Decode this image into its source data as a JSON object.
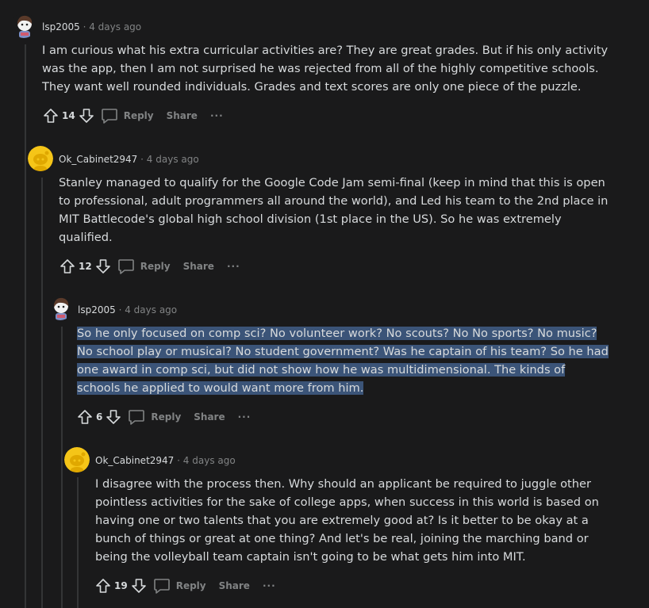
{
  "colors": {
    "background": "#1a1a1b",
    "text": "#d7dadc",
    "muted": "#818384",
    "thread_line": "#343536",
    "highlight": "#3b5478",
    "snoo_yellow": "#f5c518"
  },
  "comments": [
    {
      "username": "lsp2005",
      "separator": "·",
      "time": "4 days ago",
      "avatar": "snoo-girl-avatar",
      "paragraph": "I am curious what his extra curricular activities are? They are great grades. But if his only activity was the app, then I am not surprised he was rejected from all of the highly competitive schools. They want well rounded individuals. Grades and text scores are only one piece of the puzzle.",
      "score": "14",
      "reply_label": "Reply",
      "share_label": "Share",
      "more_label": "···"
    },
    {
      "username": "Ok_Cabinet2947",
      "separator": "·",
      "time": "4 days ago",
      "avatar": "snoo-yellow-avatar",
      "paragraph": "Stanley managed to qualify for the Google Code Jam semi-final (keep in mind that this is open to professional, adult programmers all around the world), and Led his team to the 2nd place in MIT Battlecode's global high school division (1st place in the US). So he was extremely qualified.",
      "score": "12",
      "reply_label": "Reply",
      "share_label": "Share",
      "more_label": "···"
    },
    {
      "username": "lsp2005",
      "separator": "·",
      "time": "4 days ago",
      "avatar": "snoo-girl-avatar",
      "paragraph": "So he only focused on comp sci? No volunteer work? No scouts? No No sports? No music? No school play or musical? No student government? Was he captain of his team? So he had one award in comp sci, but did not show how he was multidimensional. The kinds of schools he applied to would want more from him.",
      "score": "6",
      "reply_label": "Reply",
      "share_label": "Share",
      "more_label": "···"
    },
    {
      "username": "Ok_Cabinet2947",
      "separator": "·",
      "time": "4 days ago",
      "avatar": "snoo-yellow-avatar",
      "paragraph": "I disagree with the process then. Why should an applicant be required to juggle other pointless activities for the sake of college apps, when success in this world is based on having one or two talents that you are extremely good at? Is it better to be okay at a bunch of things or great at one thing? And let's be real, joining the marching band or being the volleyball team captain isn't going to be what gets him into MIT.",
      "score": "19",
      "reply_label": "Reply",
      "share_label": "Share",
      "more_label": "···"
    }
  ]
}
